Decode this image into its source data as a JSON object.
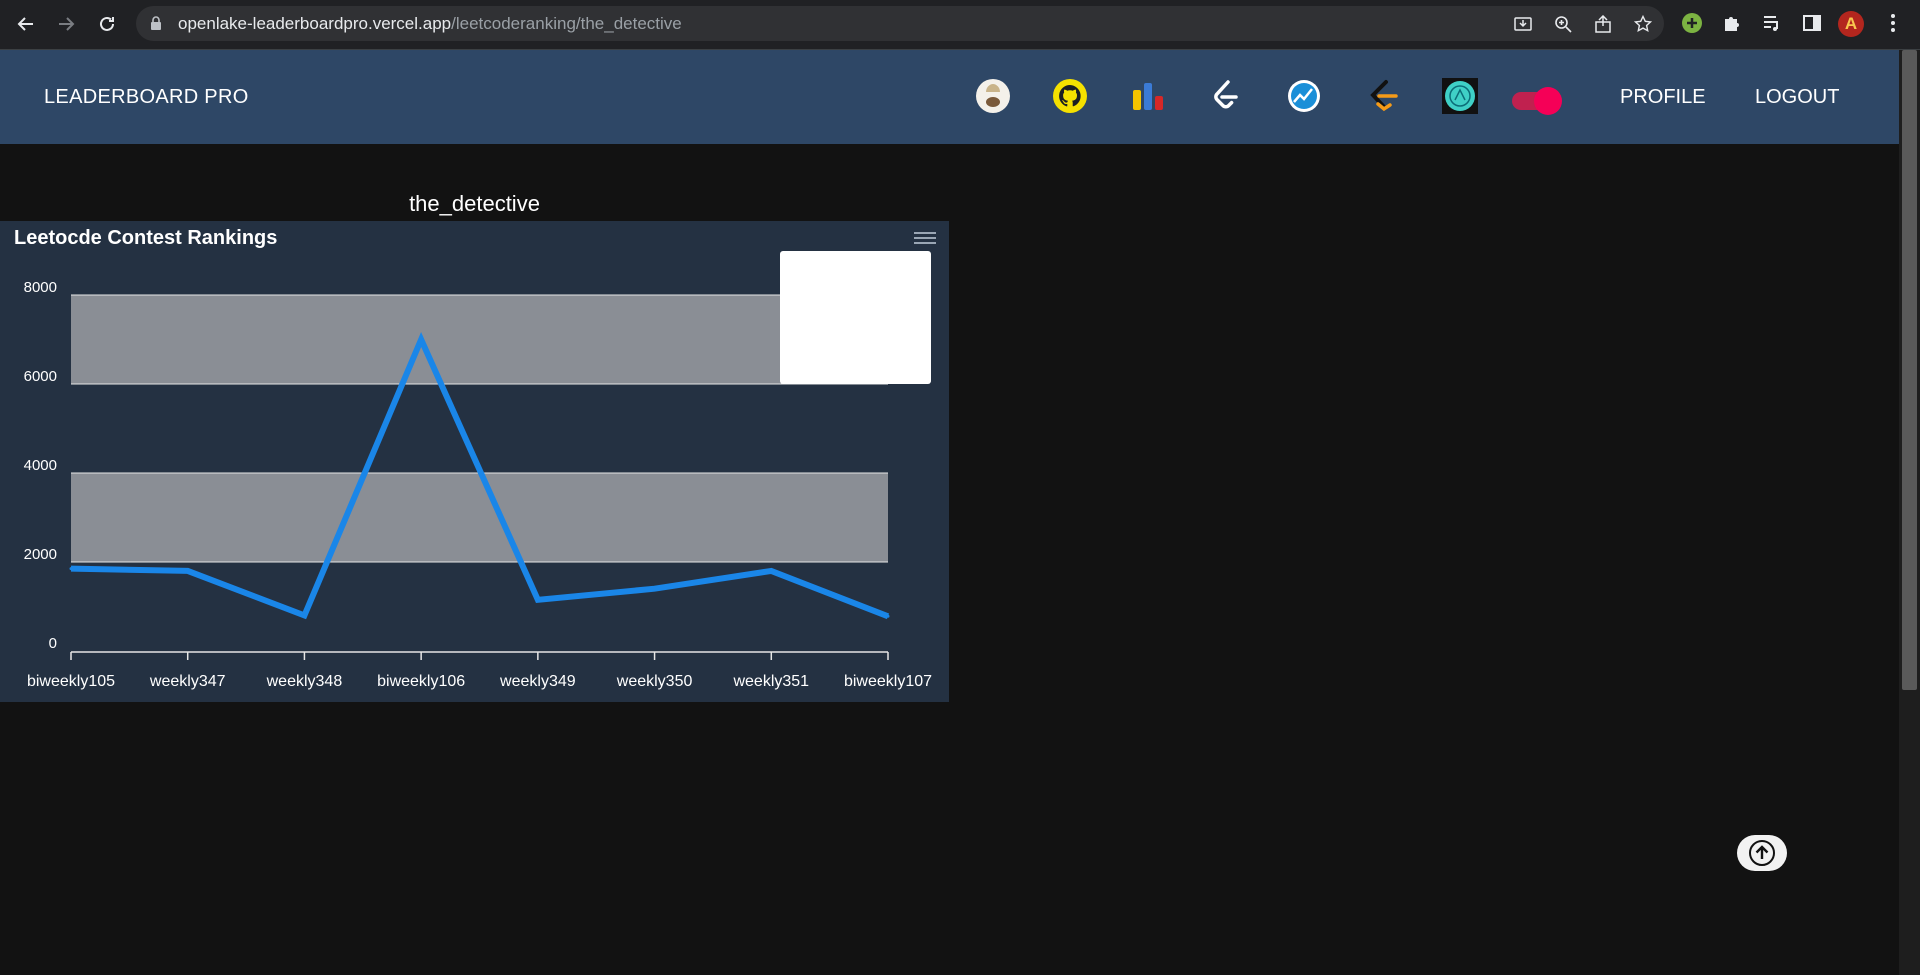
{
  "browser": {
    "url_host": "openlake-leaderboardpro.vercel.app",
    "url_path": "/leetcoderanking/the_detective",
    "toolbar_icons": [
      "back-icon",
      "forward-icon",
      "reload-icon",
      "lock-icon",
      "install-app-icon",
      "zoom-icon",
      "share-icon",
      "bookmark-star-icon",
      "extension-icon",
      "puzzle-icon",
      "media-icon",
      "sidebar-icon",
      "menu-icon"
    ],
    "profile_initial": "A"
  },
  "nav": {
    "brand": "LEADERBOARD PRO",
    "icons": [
      "codechef-icon",
      "github-icon",
      "bar-chart-icon",
      "leetcode-icon",
      "codeforces-icon",
      "leetcode-ranking-icon",
      "openlake-icon"
    ],
    "profile_label": "PROFILE",
    "logout_label": "LOGOUT",
    "accent_color": "#f50057",
    "nav_bg": "#2e4766"
  },
  "page": {
    "username": "the_detective"
  },
  "chart_data": {
    "type": "line",
    "title": "Leetocde Contest Rankings",
    "categories": [
      "biweekly105",
      "weekly347",
      "weekly348",
      "biweekly106",
      "weekly349",
      "weekly350",
      "weekly351",
      "biweekly107"
    ],
    "series": [
      {
        "values": [
          1850,
          1800,
          800,
          7000,
          1150,
          1400,
          1800,
          780
        ],
        "color": "#1a86e8"
      }
    ],
    "ylim": [
      0,
      8000
    ],
    "yticks": [
      "0",
      "2000",
      "4000",
      "6000",
      "8000"
    ],
    "bands": [
      [
        2000,
        4000
      ],
      [
        6000,
        8000
      ]
    ],
    "band_color": "#8a8e95",
    "grid": true,
    "legend": "top-right"
  }
}
